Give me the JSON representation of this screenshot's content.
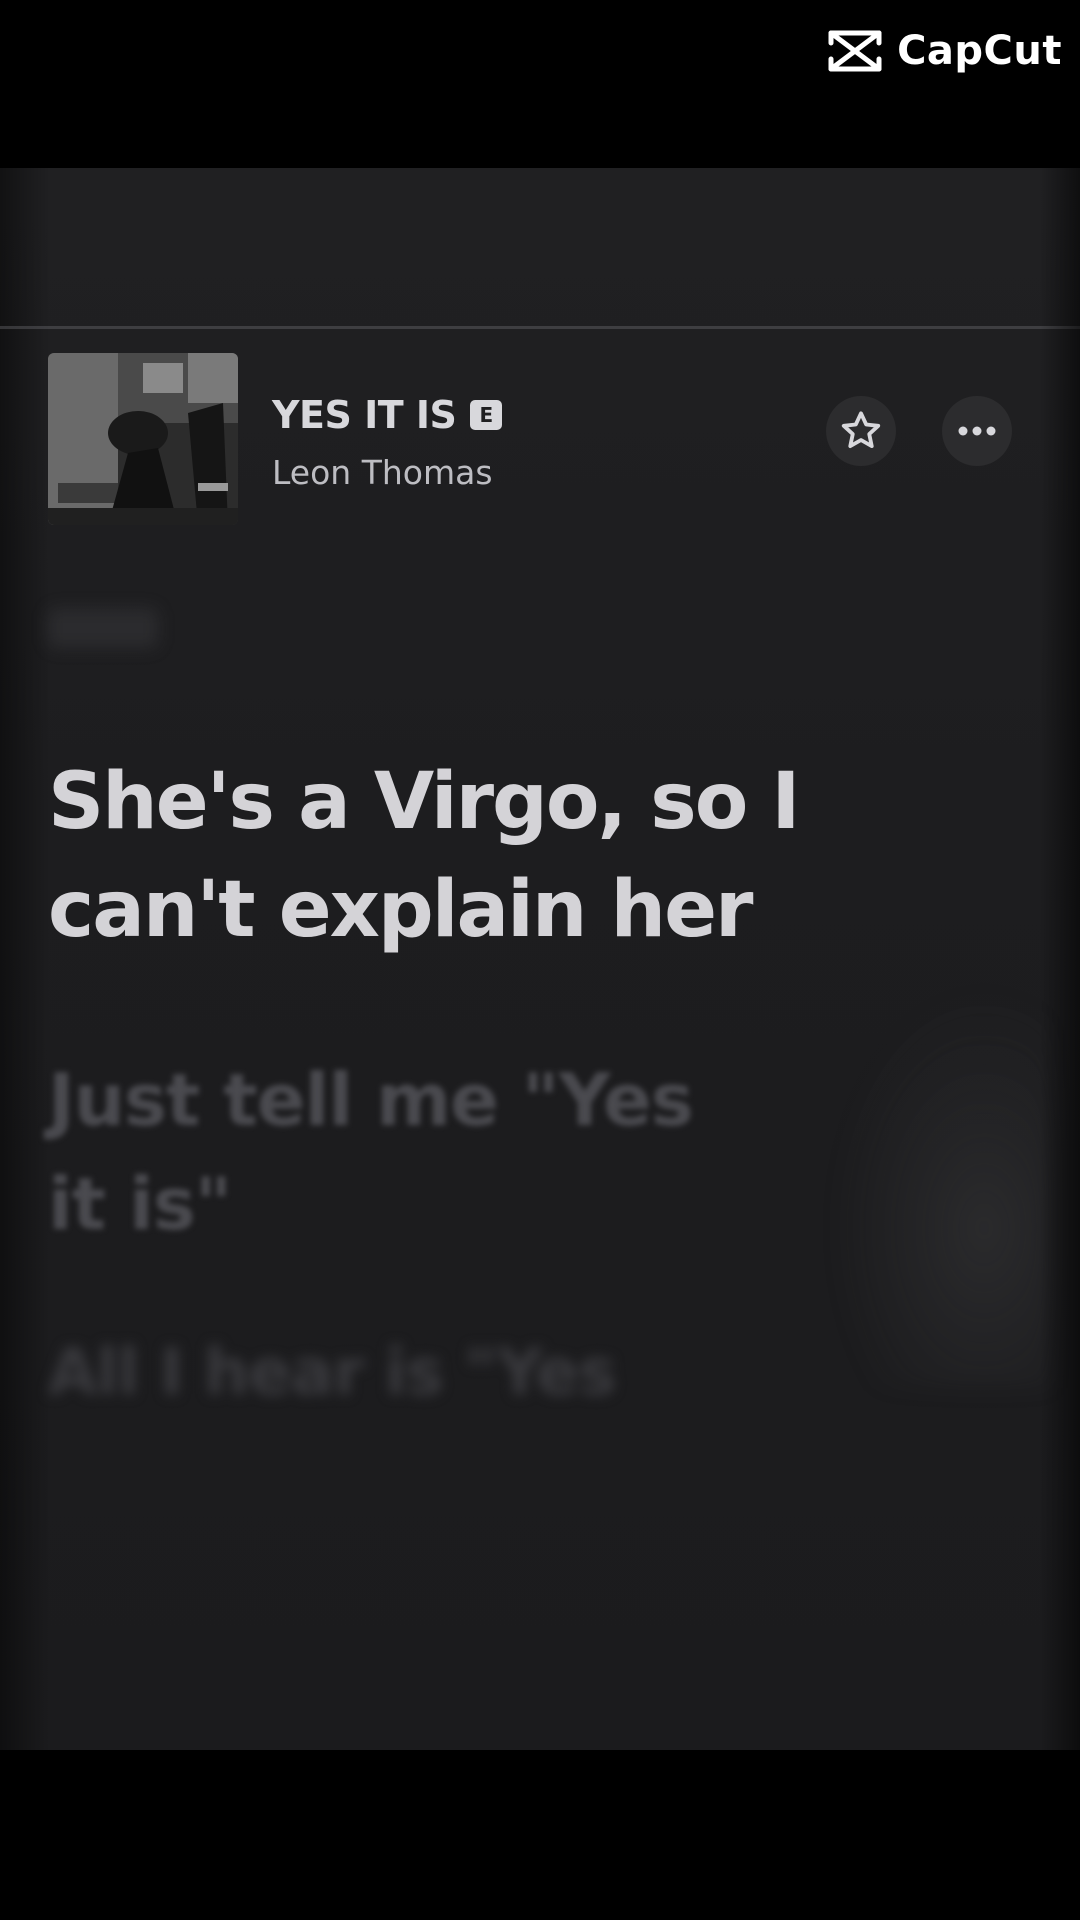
{
  "watermark": {
    "brand": "CapCut",
    "icon": "capcut-logo-icon"
  },
  "player": {
    "track_title": "YES IT IS",
    "explicit_badge": "E",
    "artist": "Leon Thomas",
    "icons": {
      "favorite": "star-outline-icon",
      "more": "ellipsis-icon"
    },
    "colors": {
      "background": "#1e1e20",
      "lyric_active": "#d4d3d7",
      "lyric_inactive": "#4a4a4f"
    }
  },
  "lyrics": {
    "current": "She's a Virgo, so I can't explain her",
    "next": "Just tell me \"Yes it is\"",
    "later": "All I hear is \"Yes"
  }
}
